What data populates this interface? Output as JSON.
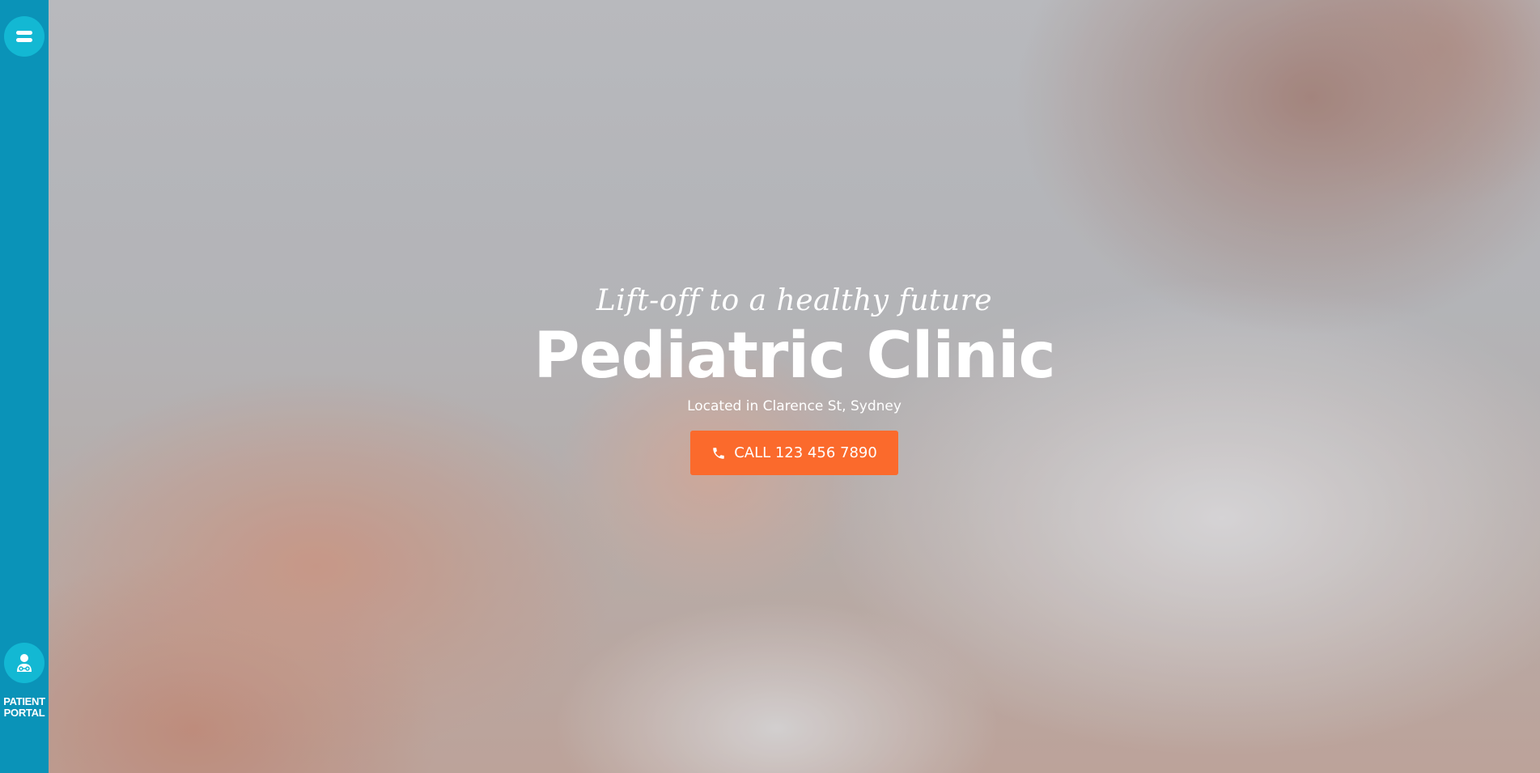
{
  "sidebar": {
    "menu_icon": "hamburger-menu-icon",
    "portal_icon": "doctor-stethoscope-icon",
    "portal_label": "PATIENT\nPORTAL"
  },
  "hero": {
    "tagline": "Lift-off to a healthy future",
    "title": "Pediatric Clinic",
    "subtitle": "Located in Clarence St, Sydney",
    "call_icon": "phone-icon",
    "call_label": "CALL 123 456 7890"
  },
  "colors": {
    "sidebar": "#0a93b8",
    "sidebar_button": "#13b8d3",
    "cta": "#fb6a2c",
    "text": "#ffffff"
  }
}
